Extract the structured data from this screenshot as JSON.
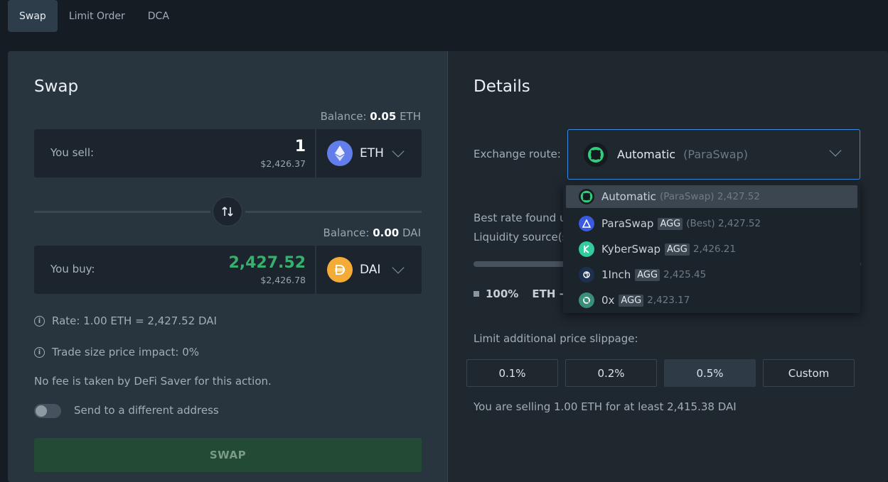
{
  "tabs": [
    {
      "label": "Swap",
      "active": true
    },
    {
      "label": "Limit Order"
    },
    {
      "label": "DCA"
    }
  ],
  "swap_panel": {
    "title": "Swap",
    "sell": {
      "balance_label": "Balance:",
      "balance_value": "0.05",
      "balance_token": "ETH",
      "label": "You sell:",
      "amount": "1",
      "usd": "$2,426.37",
      "token": "ETH",
      "token_icon": "ethereum-icon",
      "token_color": "#627eea"
    },
    "buy": {
      "balance_label": "Balance:",
      "balance_value": "0.00",
      "balance_token": "DAI",
      "label": "You buy:",
      "amount": "2,427.52",
      "usd": "$2,426.78",
      "token": "DAI",
      "token_icon": "dai-icon",
      "token_color": "#f5ac37"
    },
    "rate": "Rate: 1.00 ETH = 2,427.52 DAI",
    "impact": "Trade size price impact: 0%",
    "fee_note": "No fee is taken by DeFi Saver for this action.",
    "send_toggle_label": "Send to a different address",
    "send_toggle_on": false,
    "swap_button": "SWAP"
  },
  "details_panel": {
    "title": "Details",
    "route_label": "Exchange route:",
    "route_selected": "Automatic",
    "route_selected_sub": "(ParaSwap)",
    "best_rate_text": "Best rate found us",
    "liquidity_text": "Liquidity source(s",
    "source_percent": "100%",
    "source_pair": "ETH →",
    "slippage_label": "Limit additional price slippage:",
    "slippage_options": [
      "0.1%",
      "0.2%",
      "0.5%",
      "Custom"
    ],
    "slippage_active": "0.5%",
    "summary": "You are selling 1.00 ETH for at least 2,415.38 DAI"
  },
  "route_dropdown": [
    {
      "name": "Automatic",
      "tag": "",
      "sub": "(ParaSwap) 2,427.52",
      "icon": "automatic-icon",
      "color": "#2fcf7d",
      "selected": true
    },
    {
      "name": "ParaSwap",
      "tag": "AGG",
      "sub": "(Best) 2,427.52",
      "icon": "paraswap-icon",
      "color": "#3a5ae0"
    },
    {
      "name": "KyberSwap",
      "tag": "AGG",
      "sub": "2,426.21",
      "icon": "kyberswap-icon",
      "color": "#31cb9e"
    },
    {
      "name": "1Inch",
      "tag": "AGG",
      "sub": "2,425.45",
      "icon": "oneinch-icon",
      "color": "#1b314f"
    },
    {
      "name": "0x",
      "tag": "AGG",
      "sub": "2,423.17",
      "icon": "zerox-icon",
      "color": "#3a8f7a"
    }
  ]
}
